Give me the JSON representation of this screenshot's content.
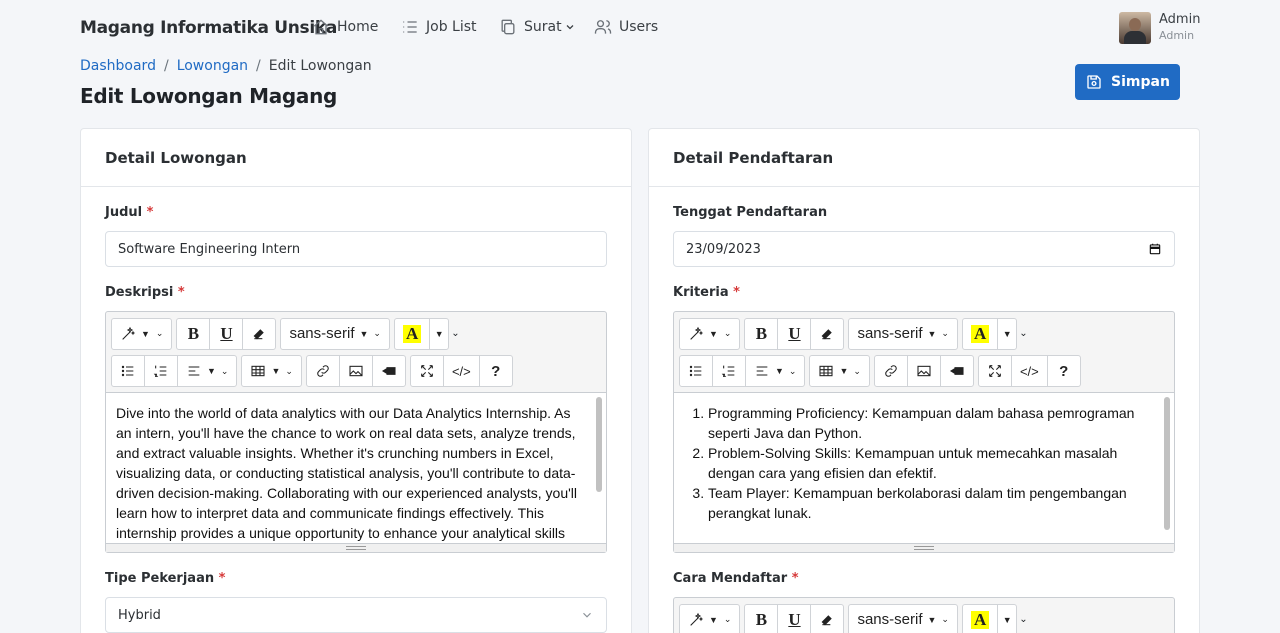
{
  "navbar": {
    "brand": "Magang Informatika Unsika",
    "items": [
      {
        "label": "Home",
        "icon": "home-icon"
      },
      {
        "label": "Job List",
        "icon": "list-icon"
      },
      {
        "label": "Surat",
        "icon": "copy-icon"
      },
      {
        "label": "Users",
        "icon": "users-icon"
      }
    ],
    "user": {
      "name": "Admin",
      "role": "Admin"
    }
  },
  "breadcrumb": {
    "items": [
      "Dashboard",
      "Lowongan",
      "Edit Lowongan"
    ],
    "separator": "/"
  },
  "page_title": "Edit Lowongan Magang",
  "save_button": {
    "label": "Simpan",
    "icon": "save-icon"
  },
  "left_card": {
    "title": "Detail Lowongan",
    "judul": {
      "label": "Judul",
      "required": "*",
      "value": "Software Engineering Intern"
    },
    "deskripsi": {
      "label": "Deskripsi",
      "required": "*",
      "text": "Dive into the world of data analytics with our Data Analytics Internship. As an intern, you'll have the chance to work on real data sets, analyze trends, and extract valuable insights. Whether it's crunching numbers in Excel, visualizing data, or conducting statistical analysis, you'll contribute to data-driven decision-making. Collaborating with our experienced analysts, you'll learn how to interpret data and communicate findings effectively. This internship provides a unique opportunity to enhance your analytical skills"
    },
    "tipe": {
      "label": "Tipe Pekerjaan",
      "required": "*",
      "value": "Hybrid"
    }
  },
  "right_card": {
    "title": "Detail Pendaftaran",
    "tenggat": {
      "label": "Tenggat Pendaftaran",
      "value": "23/09/2023"
    },
    "kriteria": {
      "label": "Kriteria",
      "required": "*",
      "items": [
        "Programming Proficiency: Kemampuan dalam bahasa pemrograman seperti Java dan Python.",
        "Problem-Solving Skills: Kemampuan untuk memecahkan masalah dengan cara yang efisien dan efektif.",
        "Team Player: Kemampuan berkolaborasi dalam tim pengembangan perangkat lunak."
      ]
    },
    "cara": {
      "label": "Cara Mendaftar",
      "required": "*"
    }
  },
  "editor_toolbar": {
    "font_name": "sans-serif",
    "bold": "B",
    "underline": "U",
    "highlight": "A",
    "help": "?",
    "code": "</>"
  },
  "colors": {
    "primary": "#206bc4",
    "required": "#d63939",
    "highlight": "#ffff00"
  }
}
